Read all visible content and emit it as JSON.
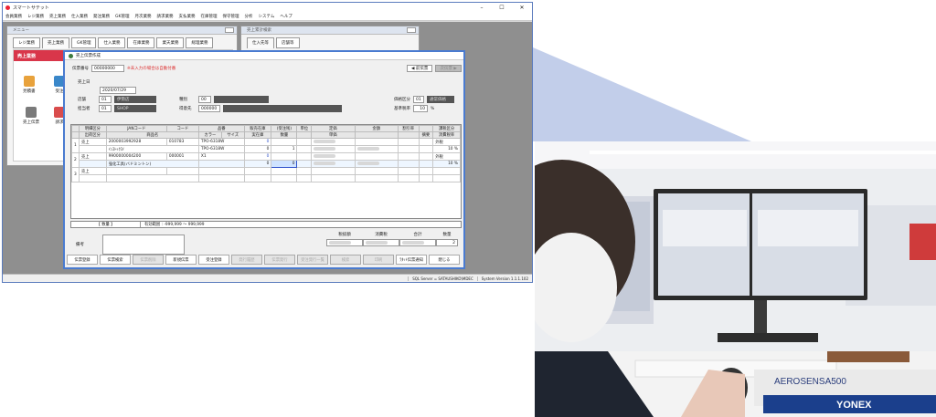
{
  "app": {
    "title": "スマートサテット",
    "menu": [
      "会員業務",
      "レジ業務",
      "売上業務",
      "仕入業務",
      "発注業務",
      "GK管理",
      "月次業務",
      "請求業務",
      "支払業務",
      "在庫管理",
      "保守管理",
      "分析",
      "システム",
      "ヘルプ"
    ],
    "status_server": "SQL Server = SATAUSHIKO\\MDEC",
    "status_version": "System Version 1.1.1.102"
  },
  "menu_window": {
    "title": "メニュー",
    "tabs": [
      "レジ業務",
      "売上業務",
      "GK管理",
      "仕入業務",
      "在庫業務",
      "業天業務",
      "総理業務"
    ],
    "panel_title": "売上業務",
    "items": [
      "見積書",
      "受注",
      "売上伝票",
      "請求"
    ],
    "item_colors": [
      "#e8a23c",
      "#3a87c9",
      "#7a7a7a",
      "#d94c4c"
    ]
  },
  "small_window": {
    "title": "売上累計検索",
    "tabs": [
      "仕入先等",
      "店舗等"
    ]
  },
  "dialog": {
    "title": "売上伝票作成",
    "denpyo_label": "伝票番号",
    "denpyo_value": "00000000",
    "notice": "※未入力の場合は自動付番",
    "nav_prev": "◀ 前伝票",
    "nav_next": "次伝票 ▶",
    "uriagebi_label": "売上日",
    "uriagebi_value": "2020/07/29",
    "tenpo_label": "店舗",
    "tenpo_code": "01",
    "tenpo_name": "伊勢店",
    "torihiki_label": "種別",
    "torihiki_code": "00",
    "tantosha_label": "担当者",
    "tantosha_code": "01",
    "tantosha_name": "SHOP",
    "tokui_label": "得意先",
    "tokui_code": "000000",
    "kakaku_label": "価格区分",
    "kakaku_code": "01",
    "kakaku_name": "通常価格",
    "kihon_label": "基準税率",
    "kihon_value": "10",
    "kihon_unit": "%"
  },
  "grid": {
    "headers_top": [
      "明細区分",
      "JANコード",
      "コード",
      "品番",
      "",
      "販売在庫",
      "(受注残)",
      "単位",
      "定価",
      "金額",
      "割引率",
      "",
      "課税区分"
    ],
    "headers_bottom": [
      "出荷区分",
      "",
      "商品名",
      "",
      "カラー",
      "サイズ",
      "実在庫",
      "数量",
      "",
      "単価",
      "",
      "",
      "摘要",
      "消費税率"
    ],
    "rows": [
      {
        "no": "1",
        "kubun": "売上",
        "jan": "2000003992928",
        "code": "010783",
        "hinban": "TPO-6318W",
        "stock": "0",
        "tax": "外税",
        "name": "ｲﾝｽﾄｯｸｽｲ",
        "name2": "TPO-6318W",
        "stock2": "0",
        "qty": "1",
        "rate": "10 %"
      },
      {
        "no": "2",
        "kubun": "売上",
        "jan": "9900000004200",
        "code": "000001",
        "hinban": "X1",
        "stock": "0",
        "tax": "外税",
        "name": "強化工具(バドミントン)",
        "name2": "",
        "stock2": "0",
        "qty": "0",
        "rate": "10 %"
      },
      {
        "no": "3",
        "kubun": "売上",
        "jan": "",
        "code": "",
        "hinban": "",
        "stock": "",
        "tax": "",
        "name": "",
        "name2": "",
        "stock2": "",
        "qty": "",
        "rate": ""
      }
    ]
  },
  "range": {
    "label": "【 数量 】",
    "text": "有効範囲 : -999,999 ～ 999,999"
  },
  "summary": {
    "biko_label": "備考",
    "labels": [
      "税抜額",
      "消費税",
      "合計",
      "数量"
    ],
    "qty": "2"
  },
  "footer_buttons": [
    {
      "label": "伝票登録",
      "enabled": true
    },
    {
      "label": "伝票検索",
      "enabled": true
    },
    {
      "label": "伝票削除",
      "enabled": false
    },
    {
      "label": "新規伝票",
      "enabled": true
    },
    {
      "label": "受注登録",
      "enabled": true
    },
    {
      "label": "発行履歴",
      "enabled": false
    },
    {
      "label": "伝票発行",
      "enabled": false
    },
    {
      "label": "受注発行一覧",
      "enabled": false
    },
    {
      "label": "検索",
      "enabled": false
    },
    {
      "label": "印刷",
      "enabled": false
    },
    {
      "label": "ﾗﾀｯﾄ伝票通知",
      "enabled": true
    },
    {
      "label": "閉じる",
      "enabled": true
    }
  ],
  "photo": {
    "monitor_brand": "",
    "banner_text": "YONEX",
    "banner_text2": "AEROSENSA500"
  }
}
